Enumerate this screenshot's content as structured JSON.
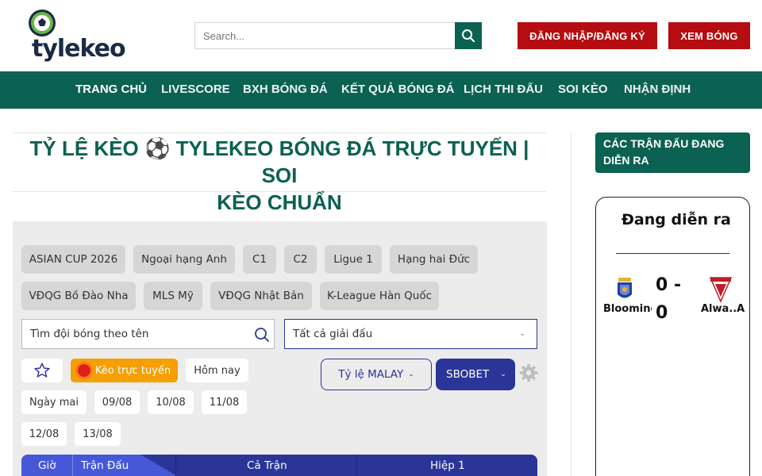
{
  "header": {
    "logo_text": "tylekeo",
    "search_placeholder": "Search...",
    "login_label": "ĐĂNG NHẬP/ĐĂNG KÝ",
    "watch_label": "XEM BÓNG"
  },
  "nav": {
    "items": [
      {
        "label": "TRANG CHỦ"
      },
      {
        "label": "LIVESCORE"
      },
      {
        "label": "BXH BÓNG ĐÁ"
      },
      {
        "label": "KẾT QUẢ BÓNG ĐÁ"
      },
      {
        "label": "LỊCH THI ĐẤU"
      },
      {
        "label": "SOI KÈO"
      },
      {
        "label": "NHẬN ĐỊNH"
      }
    ]
  },
  "page": {
    "title_line1": "TỶ LỆ KÈO ⚽ TYLEKEO BÓNG ĐÁ TRỰC TUYẾN | SOI",
    "title_line2": "KÈO CHUẨN"
  },
  "leagues": [
    "ASIAN CUP 2026",
    "Ngoại hạng Anh",
    "C1",
    "C2",
    "Ligue 1",
    "Hạng hai Đức",
    "VĐQG Bồ Đào Nha",
    "MLS Mỹ",
    "VĐQG Nhật Bản",
    "K-League Hàn Quốc"
  ],
  "filters": {
    "team_search_placeholder": "Tìm đội bóng theo tên",
    "league_select": "Tất cả giải đấu",
    "live_label": "Kèo trực tuyến",
    "days": [
      "Hôm nay",
      "Ngày mai",
      "09/08",
      "10/08",
      "11/08",
      "12/08",
      "13/08"
    ],
    "odds_type": "Tỷ lệ MALAY",
    "bookmaker": "SBOBET"
  },
  "table": {
    "headers": [
      "Giờ",
      "Trận Đấu",
      "Cả Trận",
      "Hiệp 1"
    ]
  },
  "sidebar": {
    "title": "CÁC TRẬN ĐẤU ĐANG DIỄN RA",
    "live_heading": "Đang diễn ra",
    "match": {
      "home": "Blooming",
      "away": "Alwa..A",
      "score_line1": "0 -",
      "score_line2": "0"
    }
  },
  "colors": {
    "brand_green": "#0b6152",
    "button_red": "#b50d12",
    "accent_blue": "#2b3597",
    "live_orange": "#f59f00"
  }
}
